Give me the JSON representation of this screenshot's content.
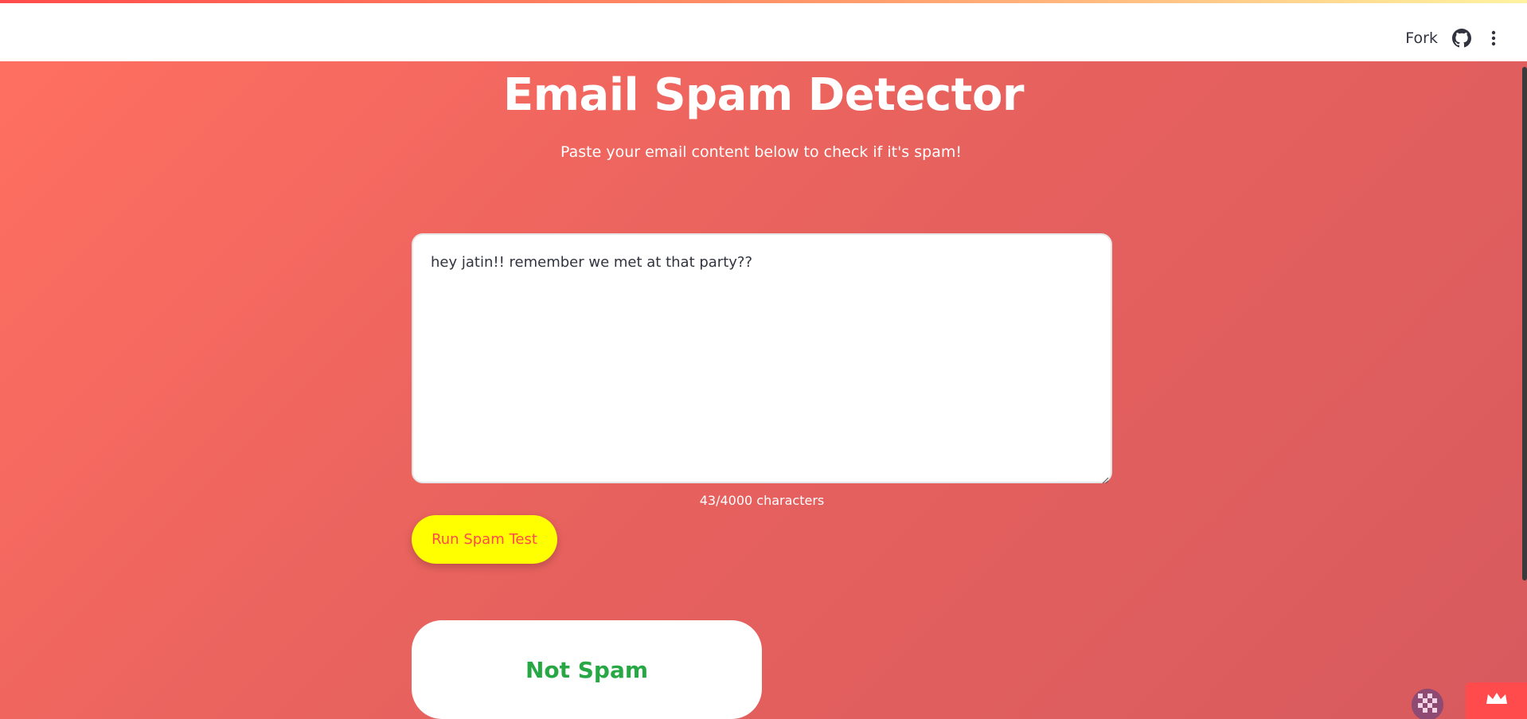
{
  "header": {
    "fork_label": "Fork",
    "github_icon": "github-icon",
    "menu_icon": "kebab-menu-icon"
  },
  "main": {
    "title": "Email Spam Detector",
    "subtitle": "Paste your email content below to check if it's spam!",
    "email_input": {
      "value": "hey jatin!! remember we met at that party??",
      "placeholder": ""
    },
    "char_count": "43/4000 characters",
    "run_button_label": "Run Spam Test",
    "result_label": "Not Spam"
  },
  "footer": {
    "avatar_icon": "user-avatar-icon",
    "badge_icon": "crown-icon"
  },
  "colors": {
    "background_gradient_start": "#ff6f61",
    "background_gradient_end": "#d85a5e",
    "button_bg": "#ffff00",
    "button_text": "#ff4b4b",
    "result_text": "#28a745"
  }
}
